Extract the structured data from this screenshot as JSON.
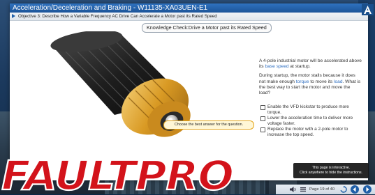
{
  "window": {
    "title": "Acceleration/Deceleration and Braking  -  W11135-XA03UEN-E1"
  },
  "objective": {
    "text": "Objective 3: Describe How a Variable Frequency AC Drive Can Accelerate a Motor past its Rated Speed"
  },
  "knowledge_check": {
    "title": "Knowledge Check:Drive a Motor past its Rated Speed"
  },
  "prompt": {
    "choose_label": "Choose the best answer for the question."
  },
  "question": {
    "para1_a": "A 4-pole industrial motor will be accelerated above its ",
    "para1_kw": "base speed",
    "para1_b": " at startup.",
    "para2_a": "During startup, the motor stalls because it does not make enough ",
    "para2_kw1": "torque",
    "para2_b": " to move its ",
    "para2_kw2": "load",
    "para2_c": ". What is the best way to start the motor and move the load?"
  },
  "options": [
    {
      "label": "Enable the VFD kickstar to produce more torque."
    },
    {
      "label": "Lower the acceleration time to deliver more voltage faster."
    },
    {
      "label": "Replace the motor with a 2-pole motor to increase the top speed."
    }
  ],
  "tooltip": {
    "line1": "This page is interactive.",
    "line2": "Click anywhere to hide the instructions."
  },
  "footer": {
    "page_indicator": "Page 19 of 40"
  },
  "brand": {
    "wordmark": "FAULTPRO"
  },
  "colors": {
    "titlebar": "#1f5fa8",
    "keyword": "#2f6fc0",
    "highlight": "#e3a51d",
    "brand_red": "#d3131b"
  }
}
